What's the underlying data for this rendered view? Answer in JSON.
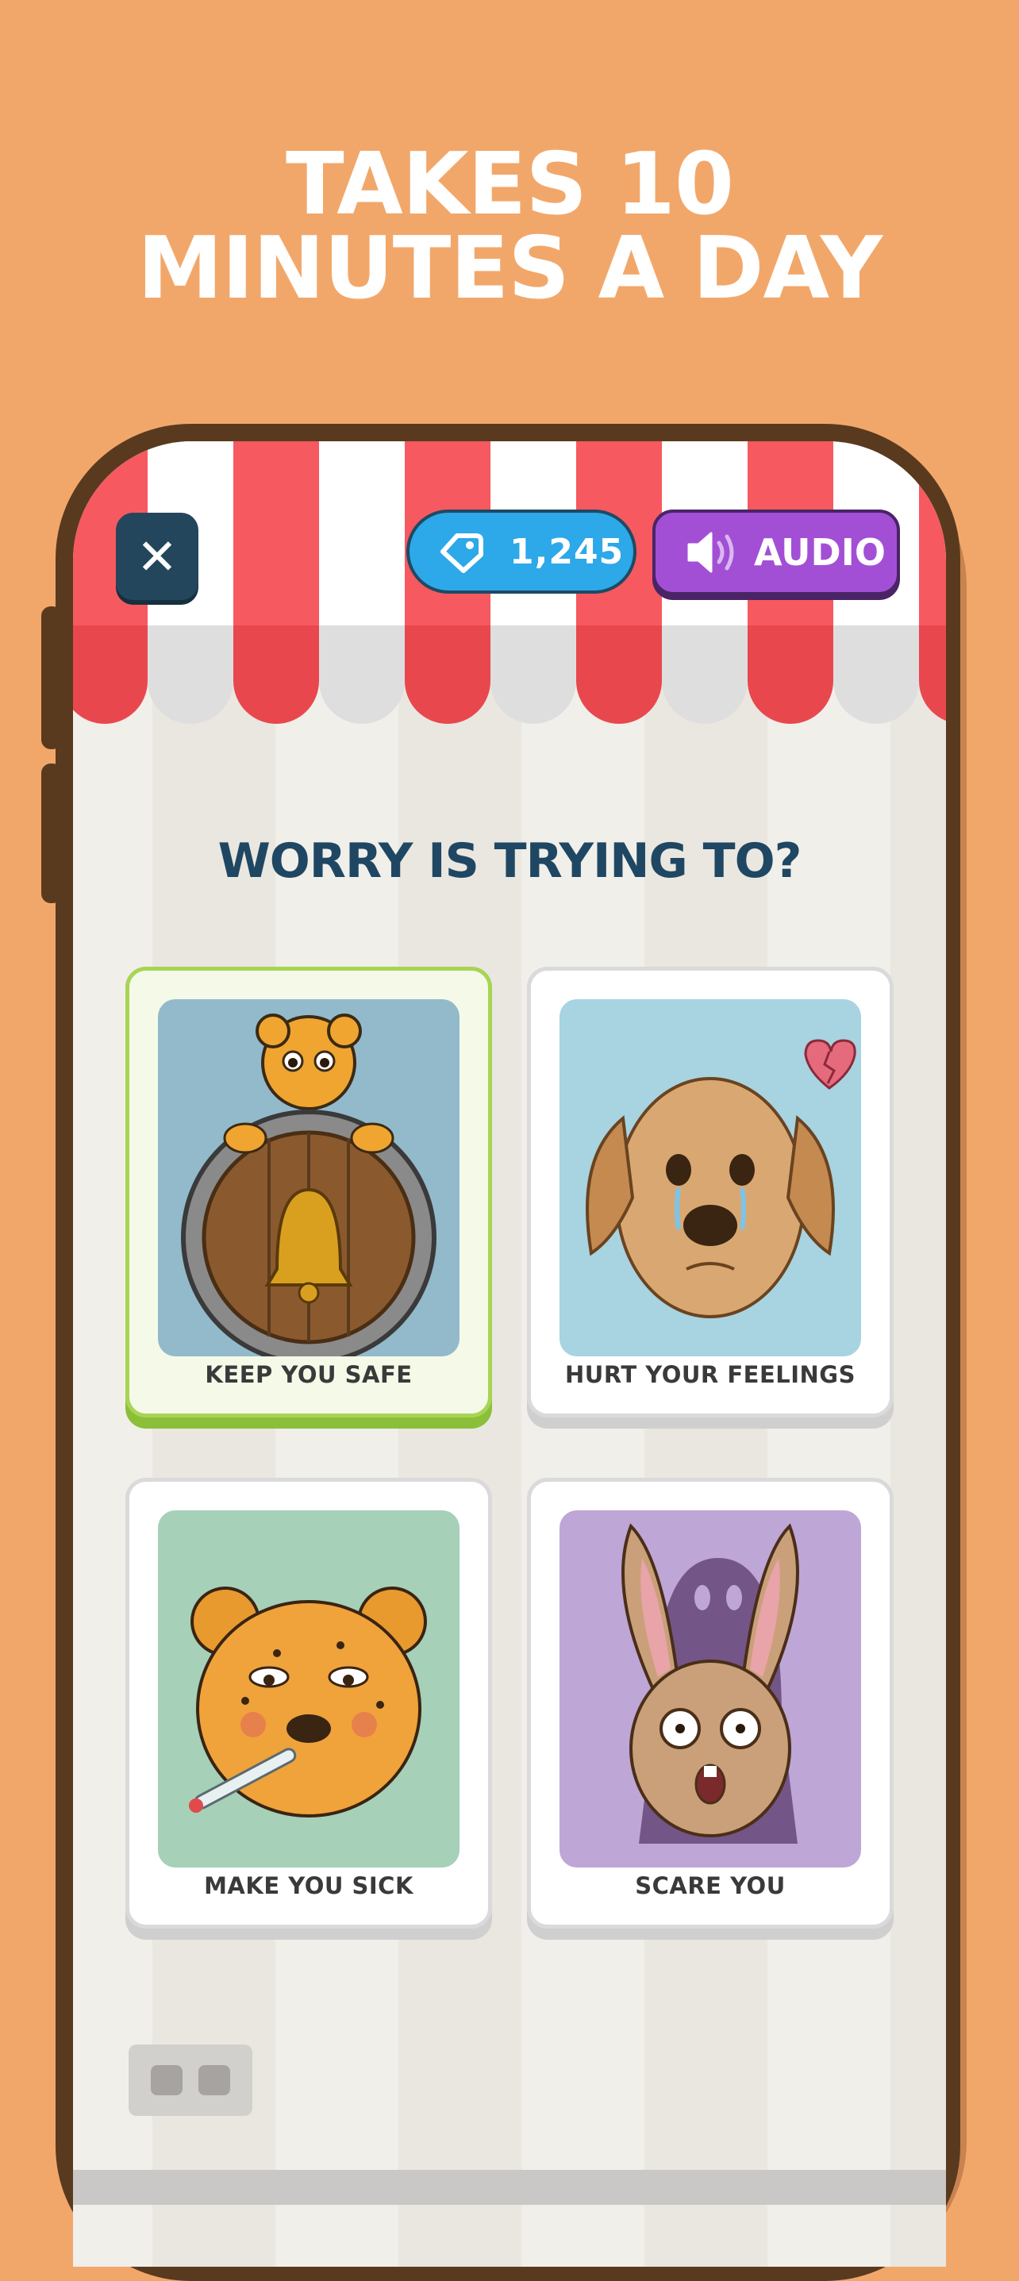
{
  "promo": {
    "line1": "TAKES 10",
    "line2": "MINUTES A DAY"
  },
  "top_bar": {
    "close_glyph": "✕",
    "gems": {
      "icon": "gem-icon",
      "count": "1,245"
    },
    "audio": {
      "icon": "speaker-icon",
      "label": "AUDIO"
    }
  },
  "question": "WORRY IS TRYING TO?",
  "answers": [
    {
      "label": "KEEP YOU SAFE",
      "selected": true,
      "art": "cheetah-with-bell-shield",
      "bg": "#93BACB"
    },
    {
      "label": "HURT YOUR FEELINGS",
      "selected": false,
      "art": "crying-dog-broken-heart",
      "bg": "#A8D3E0"
    },
    {
      "label": "MAKE YOU SICK",
      "selected": false,
      "art": "sick-cheetah-thermometer",
      "bg": "#A6D0B8"
    },
    {
      "label": "SCARE YOU",
      "selected": false,
      "art": "scared-rabbit-ghost",
      "bg": "#BEA6D6"
    }
  ],
  "colors": {
    "background": "#F2A76A",
    "awning_red": "#F6595F",
    "selected_border": "#A8D455",
    "question_text": "#1F4763",
    "gem_pill": "#2DA8E8",
    "audio_button": "#A24FD6"
  }
}
